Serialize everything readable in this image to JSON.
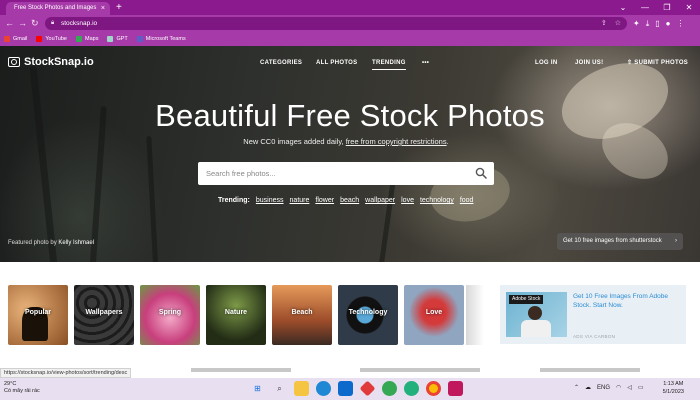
{
  "browser": {
    "tab_title": "Free Stock Photos and Images",
    "tab_close": "×",
    "new_tab": "+",
    "url": "stocksnap.io",
    "window_controls": [
      "⌄",
      "—",
      "❐",
      "✕"
    ],
    "bookmarks": [
      {
        "label": "Gmail",
        "color": "#ea4335"
      },
      {
        "label": "YouTube",
        "color": "#ff0000"
      },
      {
        "label": "Maps",
        "color": "#34a853"
      },
      {
        "label": "GPT",
        "color": "#9fd6c8"
      },
      {
        "label": "Microsoft Teams",
        "color": "#5b5fc7"
      }
    ]
  },
  "site": {
    "logo": "StockSnap.io",
    "nav": {
      "categories": "CATEGORIES",
      "all_photos": "ALL PHOTOS",
      "trending": "TRENDING",
      "more": "•••",
      "login": "LOG IN",
      "join": "JOIN US!",
      "submit": "SUBMIT PHOTOS"
    },
    "hero": {
      "title": "Beautiful Free Stock Photos",
      "subtitle_prefix": "New CC0 images added daily, ",
      "subtitle_link": "free from copyright restrictions",
      "subtitle_suffix": ".",
      "search_placeholder": "Search free photos...",
      "trending_label": "Trending:",
      "trending_tags": [
        "business",
        "nature",
        "flower",
        "beach",
        "wallpaper",
        "love",
        "technology",
        "food"
      ],
      "featured_prefix": "Featured photo by ",
      "featured_author": "Kelly Ishmael",
      "promo": "Get 10 free images from shutterstock",
      "promo_arrow": "›"
    },
    "categories": [
      {
        "label": "Popular",
        "bg": "#c98b4a"
      },
      {
        "label": "Wallpapers",
        "bg": "#2a2a2a"
      },
      {
        "label": "Spring",
        "bg": "#d8639a"
      },
      {
        "label": "Nature",
        "bg": "#3e4a2a"
      },
      {
        "label": "Beach",
        "bg": "#b36a3b"
      },
      {
        "label": "Technology",
        "bg": "#1f2a36"
      },
      {
        "label": "Love",
        "bg": "#5a6f8a"
      }
    ],
    "ad": {
      "brand": "Adobe Stock",
      "text": "Get 10 Free Images From Adobe Stock. Start Now.",
      "via": "ADS VIA CARBON"
    }
  },
  "status_url": "https://stocksnap.io/view-photos/sort/trending/desc",
  "taskbar": {
    "temp": "29°C",
    "weather": "Có mây rải rác",
    "lang": "ENG",
    "time": "1:13 AM",
    "date": "5/1/2023"
  }
}
